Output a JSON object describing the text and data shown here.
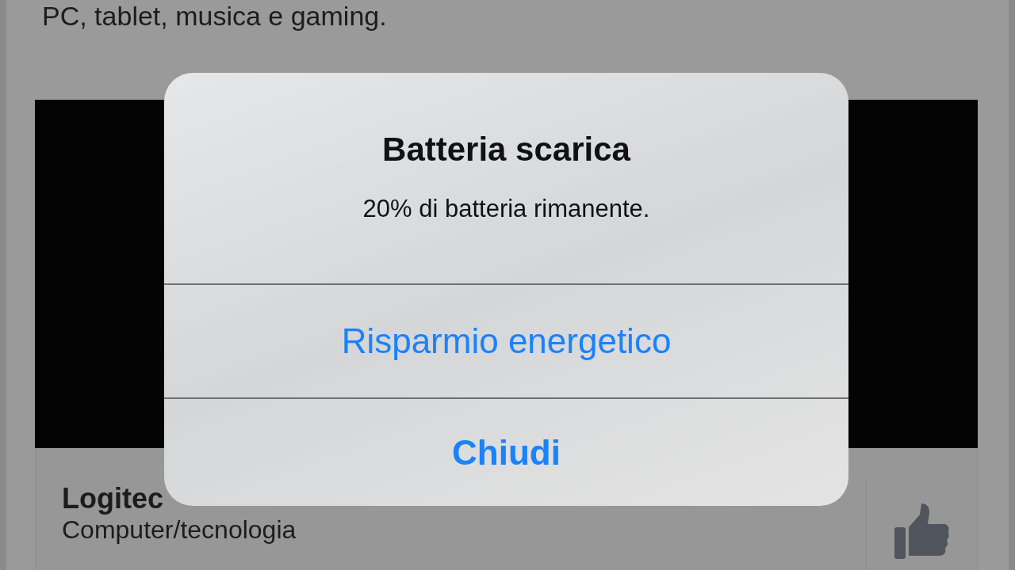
{
  "page": {
    "description": "PC, tablet, musica e gaming.",
    "post": {
      "name": "Logitec",
      "category": "Computer/tecnologia"
    }
  },
  "alert": {
    "title": "Batteria scarica",
    "message": "20% di batteria rimanente.",
    "actions": [
      {
        "label": "Risparmio energetico",
        "kind": "default"
      },
      {
        "label": "Chiudi",
        "kind": "preferred"
      }
    ]
  }
}
